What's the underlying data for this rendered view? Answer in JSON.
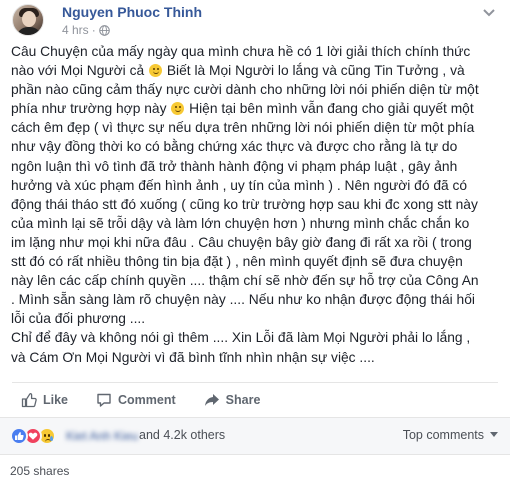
{
  "post": {
    "author": "Nguyen Phuoc Thinh",
    "time": "4 hrs",
    "separator": "·",
    "paragraphs": [
      [
        "Câu Chuyện của mấy ngày qua mình chưa hề có 1 lời giải thích chính thức",
        "nào với Mọi Người cả",
        " Biết là Mọi Người lo lắng và cũng Tin Tưởng , và",
        "phần nào cũng cảm thấy nực cười dành cho những lời nói phiến diện từ một",
        "phía như trường hợp này",
        " Hiện tại bên mình vẫn đang cho giải quyết một",
        "cách êm đẹp ( vì thực sự nếu dựa trên những lời nói phiến diện từ một phía",
        "như vậy đồng thời ko có bằng chứng xác thực và được cho rằng là tự do",
        "ngôn luận thì vô tình đã trở thành hành động vi phạm pháp luật , gây ảnh",
        "hưởng và xúc phạm đến hình ảnh , uy tín của mình ) . Nên người đó đã có",
        "động thái tháo stt đó xuống ( cũng ko trừ trường hợp sau khi đc xong stt này",
        "của mình lại sẽ trỗi dậy và làm lớn chuyện hơn ) nhưng mình chắc chắn ko",
        "im lặng như mọi khi nữa đâu . Câu chuyện bây giờ đang đi rất xa rồi ( trong",
        "stt đó có rất nhiều thông tin bịa đặt ) , nên mình quyết định sẽ đưa chuyện",
        "này lên các cấp chính quyền .... thậm chí sẽ nhờ đến sự hỗ trợ của Công An",
        ". Mình sẵn sàng làm rõ chuyện này .... Nếu như ko nhận được động thái hối",
        "lỗi của đối phương ...."
      ],
      [
        "Chỉ để đây và không nói gì thêm .... Xin Lỗi đã làm Mọi Người phải lo lắng ,",
        "và Cám Ơn Mọi Người vì đã bình tĩnh nhìn nhận sự việc ...."
      ]
    ]
  },
  "actions": {
    "like": "Like",
    "comment": "Comment",
    "share": "Share"
  },
  "reactions": {
    "names": "Kiet Anh Kieu",
    "others": "and 4.2k others",
    "sort": "Top comments"
  },
  "shares": "205 shares",
  "colors": {
    "link": "#365899",
    "text": "#1d2129",
    "muted": "#90949c",
    "like": "#4a7ef0",
    "love": "#f0425e",
    "sad": "#f7c934"
  },
  "icons": [
    "globe-icon",
    "options-icon",
    "like-icon",
    "comment-icon",
    "share-icon",
    "like-reaction-icon",
    "love-reaction-icon",
    "sad-reaction-icon",
    "caret-down-icon",
    "smile-emoji",
    "grin-emoji"
  ]
}
